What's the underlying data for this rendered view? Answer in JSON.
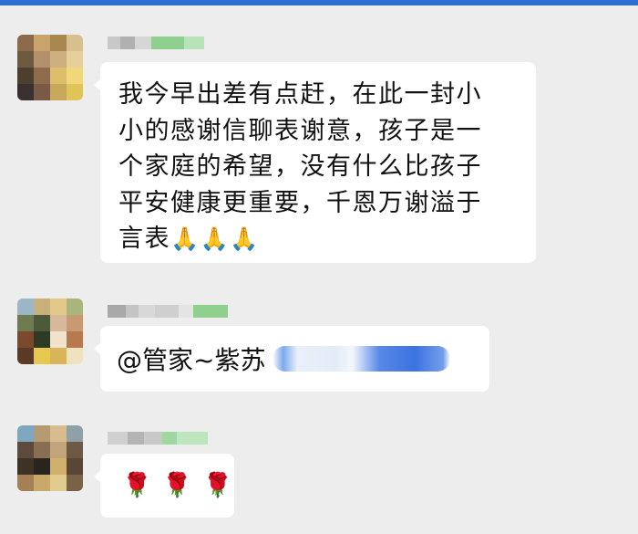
{
  "messages": [
    {
      "text_lines": [
        "我今早出差有点赶，在此一封小",
        "小的感谢信聊表谢意，孩子是一",
        "个家庭的希望，没有什么比孩子",
        "平安健康更重要，千恩万谢溢于",
        "言表"
      ],
      "emojis": [
        "🙏",
        "🙏",
        "🙏"
      ]
    },
    {
      "mention": "@管家~紫苏"
    },
    {
      "emojis": [
        "🌹",
        "🌹",
        "🌹"
      ]
    }
  ],
  "colors": {
    "background": "#EDEDED",
    "bubble": "#FFFFFF",
    "top_accent": "#2E6FD1"
  }
}
